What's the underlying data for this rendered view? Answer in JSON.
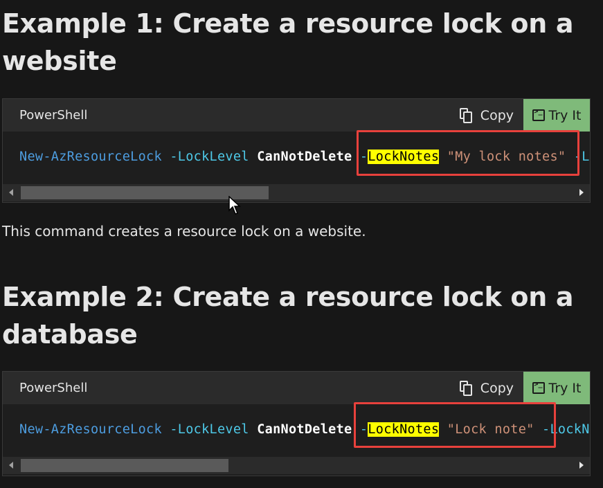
{
  "examples": [
    {
      "title": "Example 1: Create a resource lock on a website",
      "language": "PowerShell",
      "copy_label": "Copy",
      "try_label": "Try It",
      "code": {
        "cmd": "New-AzResourceLock",
        "p1": "-LockLevel",
        "v1": "CanNotDelete",
        "dash": "-",
        "p2_highlight": "LockNotes",
        "str": "\"My lock notes\"",
        "trail": " -L"
      },
      "description": "This command creates a resource lock on a website.",
      "scroll_fraction": 0.42
    },
    {
      "title": "Example 2: Create a resource lock on a database",
      "language": "PowerShell",
      "copy_label": "Copy",
      "try_label": "Try It",
      "code": {
        "cmd": "New-AzResourceLock",
        "p1": "-LockLevel",
        "v1": "CanNotDelete",
        "dash": "-",
        "p2_highlight": "LockNotes",
        "str": "\"Lock note\"",
        "trail": " -LockN"
      },
      "scroll_fraction": 0.35
    }
  ],
  "colors": {
    "try_button": "#7fba7a",
    "highlight": "#ffff00",
    "annotation_box": "#e8413c",
    "cmdlet": "#4d9de0",
    "parameter": "#4ec9e8",
    "string": "#ce9178"
  }
}
